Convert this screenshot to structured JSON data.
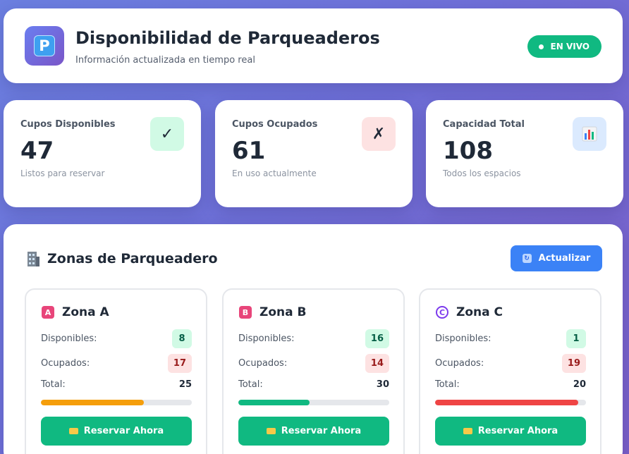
{
  "header": {
    "title": "Disponibilidad de Parqueaderos",
    "subtitle": "Información actualizada en tiempo real",
    "logo_letter": "P",
    "live_label": "EN VIVO"
  },
  "stats": [
    {
      "label": "Cupos Disponibles",
      "value": "47",
      "sub": "Listos para reservar",
      "icon": "check-icon",
      "glyph": "✓"
    },
    {
      "label": "Cupos Ocupados",
      "value": "61",
      "sub": "En uso actualmente",
      "icon": "x-icon",
      "glyph": "✗"
    },
    {
      "label": "Capacidad Total",
      "value": "108",
      "sub": "Todos los espacios",
      "icon": "bar-chart-icon",
      "glyph": ""
    }
  ],
  "zones_section": {
    "title": "Zonas de Parqueadero",
    "refresh_label": "Actualizar",
    "labels": {
      "available": "Disponibles:",
      "occupied": "Ocupados:",
      "total": "Total:"
    },
    "reserve_label": "Reservar Ahora"
  },
  "zones": [
    {
      "name": "Zona A",
      "badge": "A",
      "available": "8",
      "occupied": "17",
      "total": "25",
      "occupancy": 0.68,
      "bar_color": "#f59e0b"
    },
    {
      "name": "Zona B",
      "badge": "B",
      "available": "16",
      "occupied": "14",
      "total": "30",
      "occupancy": 0.47,
      "bar_color": "#10b981"
    },
    {
      "name": "Zona C",
      "badge": "C",
      "available": "1",
      "occupied": "19",
      "total": "20",
      "occupancy": 0.95,
      "bar_color": "#ef4444"
    }
  ],
  "colors": {
    "accent_green": "#10b981",
    "accent_blue": "#3b82f6"
  }
}
